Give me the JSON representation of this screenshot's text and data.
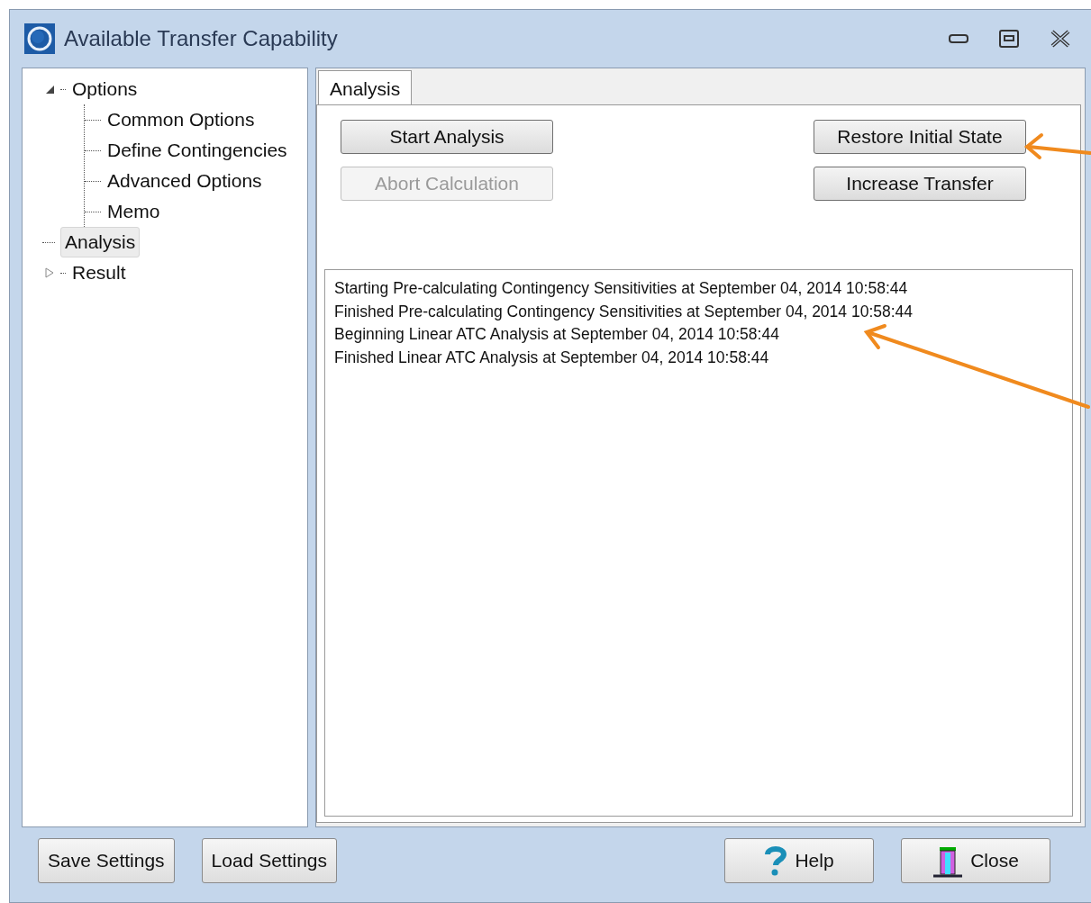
{
  "window": {
    "title": "Available Transfer Capability"
  },
  "tree": [
    {
      "label": "Options",
      "expanded": true,
      "selected": false,
      "children": [
        {
          "label": "Common Options",
          "selected": false
        },
        {
          "label": "Define Contingencies",
          "selected": false
        },
        {
          "label": "Advanced Options",
          "selected": false
        },
        {
          "label": "Memo",
          "selected": false
        }
      ]
    },
    {
      "label": "Analysis",
      "selected": true
    },
    {
      "label": "Result",
      "expanded": false,
      "selected": false
    }
  ],
  "tabs": [
    {
      "label": "Analysis",
      "selected": true
    }
  ],
  "buttons_left": [
    {
      "label": "Start Analysis",
      "disabled": false
    },
    {
      "label": "Abort Calculation",
      "disabled": true
    }
  ],
  "buttons_right": [
    {
      "label": "Restore Initial State",
      "disabled": false
    },
    {
      "label": "Increase Transfer",
      "disabled": false
    }
  ],
  "log": [
    "Starting Pre-calculating Contingency Sensitivities at September 04, 2014 10:58:44",
    "Finished Pre-calculating Contingency Sensitivities at September 04, 2014 10:58:44",
    "Beginning Linear ATC Analysis at September 04, 2014 10:58:44",
    "Finished Linear ATC Analysis at September 04, 2014 10:58:44"
  ],
  "footer_buttons": [
    {
      "label": "Save Settings",
      "kind": "plain"
    },
    {
      "label": "Load Settings",
      "kind": "plain"
    },
    {
      "label": "Help",
      "kind": "help"
    },
    {
      "label": "Close",
      "kind": "close"
    }
  ]
}
